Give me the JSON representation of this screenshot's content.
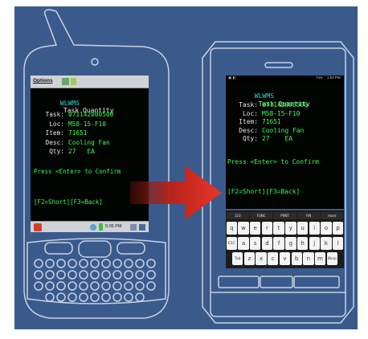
{
  "left_device": {
    "topbar": {
      "menu_label": "Options"
    },
    "app": {
      "name": "WLWMS",
      "title": "Task Quantity"
    },
    "fields": [
      {
        "label": "Task:",
        "value": "071142000500"
      },
      {
        "label": "Loc:",
        "value": "M58-15-F10"
      },
      {
        "label": "Item:",
        "value": "71651"
      },
      {
        "label": "Desc:",
        "value": "Cooling Fan"
      },
      {
        "label": "Qty:",
        "value": "27   EA"
      }
    ],
    "prompt": "Press <Enter> to Confirm",
    "softkeys": "[F2=Short][F3=Back]",
    "taskbar": {
      "time": "5:05 PM"
    }
  },
  "right_device": {
    "statusbar": {
      "time": "1:53 PM",
      "battery": "74%"
    },
    "app": {
      "name": "WLWMS",
      "title": "Task Quantity"
    },
    "fields": [
      {
        "label": "Task:",
        "value": "071142000500"
      },
      {
        "label": "Loc:",
        "value": "M58-15-F10"
      },
      {
        "label": "Item:",
        "value": "71651"
      },
      {
        "label": "Desc:",
        "value": "Cooling Fan"
      },
      {
        "label": "Qty:",
        "value": "27    EA"
      }
    ],
    "prompt": "Press <Enter> to Confirm",
    "softkeys": "[F2=Short][F3=Back]",
    "keyboard": {
      "function_row": [
        "123",
        "FUNC",
        "PRNT",
        "Y/N",
        "more"
      ],
      "rows": [
        [
          "q",
          "w",
          "e",
          "r",
          "t",
          "y",
          "u",
          "i",
          "o",
          "p"
        ],
        [
          "ESC",
          "a",
          "s",
          "d",
          "f",
          "g",
          "h",
          "j",
          "k",
          "l"
        ],
        [
          "Tab",
          "z",
          "x",
          "c",
          "v",
          "b",
          "n",
          "m",
          "Bksp"
        ]
      ]
    }
  },
  "colors": {
    "background": "#3b5a8c",
    "arrow": "#d42a1e",
    "terminal_green": "#39ff4f",
    "terminal_cyan": "#23d6d6"
  }
}
